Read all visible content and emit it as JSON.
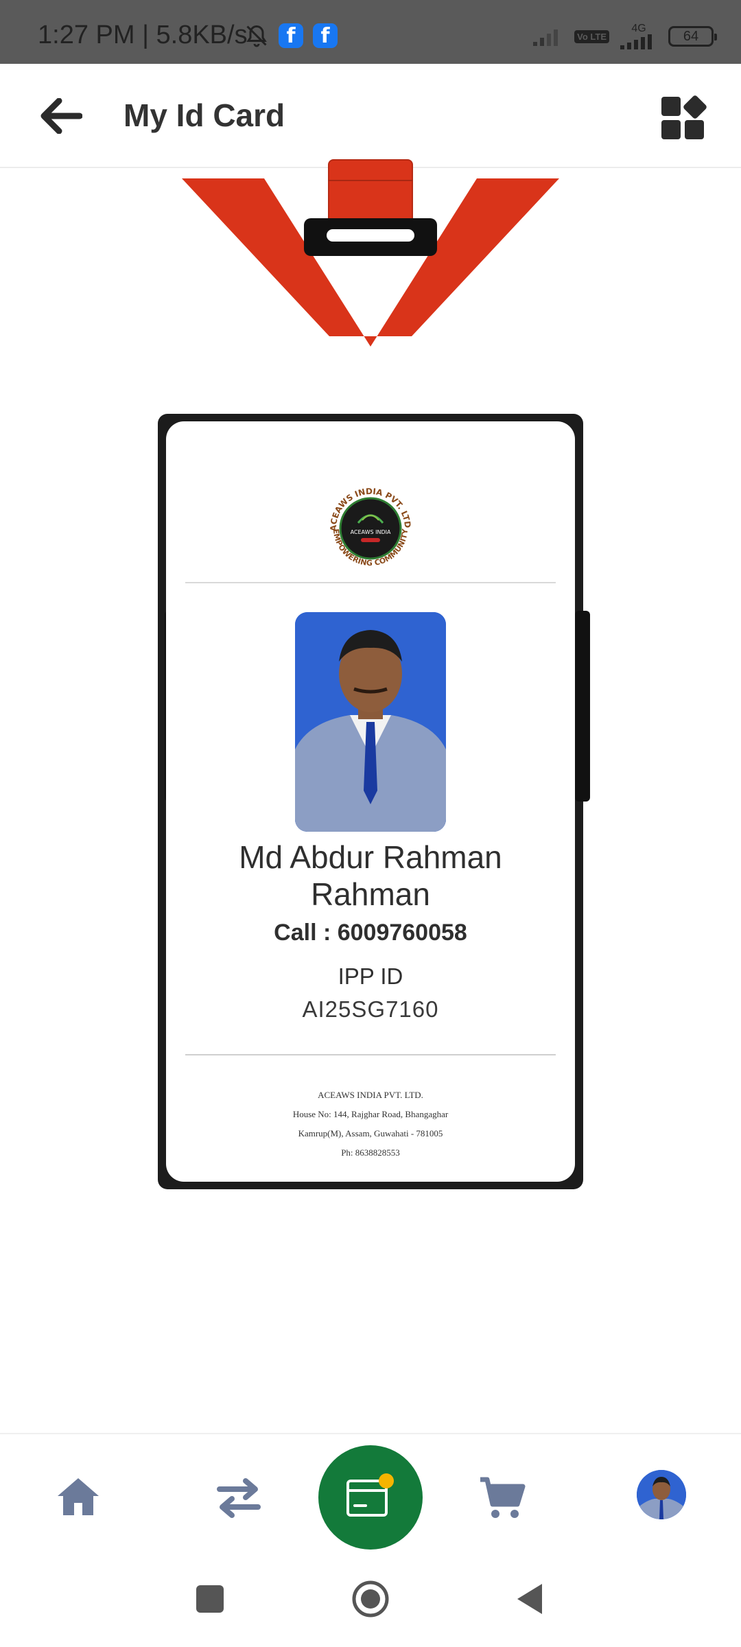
{
  "status_bar": {
    "time_speed": "1:27 PM | 5.8KB/s",
    "fb_label": "f",
    "volte": "Vo LTE",
    "network": "4G",
    "battery": "64"
  },
  "app_bar": {
    "title": "My Id Card"
  },
  "card": {
    "logo_text_top": "ACEAWS INDIA PVT. LTD.",
    "logo_text_bottom": "EMPOWERING COMMUNITY",
    "logo_center": "ACEAWS INDIA",
    "name": "Md Abdur Rahman Rahman",
    "call": "Call : 6009760058",
    "ipp_label": "IPP ID",
    "ipp_value": "AI25SG7160",
    "company": "ACEAWS INDIA PVT. LTD.",
    "address_line1": "House No: 144, Rajghar Road, Bhangaghar",
    "address_line2": "Kamrup(M), Assam, Guwahati - 781005",
    "phone": "Ph: 8638828553"
  },
  "colors": {
    "lanyard": "#d9341a",
    "primary_green": "#137a3a",
    "nav_icon": "#6b7a9a",
    "notification_dot": "#f5b400"
  },
  "icons": {
    "back": "arrow-left-icon",
    "menu": "grid-diamond-icon",
    "home": "home-icon",
    "transfer": "transfer-arrows-icon",
    "card": "id-card-icon",
    "cart": "cart-icon"
  }
}
